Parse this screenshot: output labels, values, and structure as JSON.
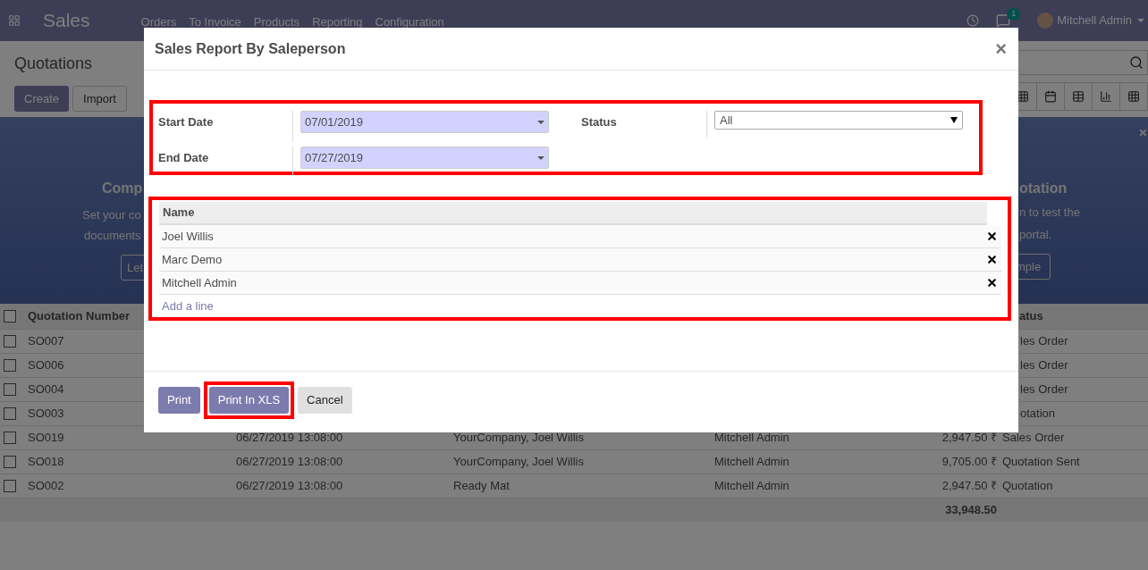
{
  "navbar": {
    "app": "Sales",
    "menu": [
      "Orders",
      "To Invoice",
      "Products",
      "Reporting",
      "Configuration"
    ],
    "notifications": "1",
    "user": "Mitchell Admin"
  },
  "control_panel": {
    "title": "Quotations",
    "buttons": [
      {
        "label": "Create",
        "kind": "primary"
      },
      {
        "label": "Import",
        "kind": "secondary"
      }
    ]
  },
  "banner": {
    "left": {
      "heading": "Comp",
      "lines": [
        "Set your co",
        "documents"
      ],
      "button": "Let"
    },
    "right": {
      "heading": "otation",
      "lines": [
        "n to test the",
        "portal."
      ],
      "button": "mple"
    }
  },
  "table": {
    "columns": [
      {
        "label": "Quotation Number",
        "kind": "number"
      },
      {
        "label": "atus",
        "kind": "status"
      }
    ],
    "rows": [
      {
        "kind": "covered",
        "checked": false,
        "number": "SO007",
        "status": "les Order"
      },
      {
        "kind": "covered",
        "checked": false,
        "number": "SO006",
        "status": "les Order"
      },
      {
        "kind": "covered",
        "checked": false,
        "number": "SO004",
        "status": "les Order"
      },
      {
        "kind": "covered",
        "checked": false,
        "number": "SO003",
        "status": "otation"
      },
      {
        "kind": "full",
        "checked": false,
        "number": "SO019",
        "date": "06/27/2019 13:08:00",
        "customer": "YourCompany, Joel Willis",
        "salesperson": "Mitchell Admin",
        "total": "2,947.50 ₹",
        "status": "Sales Order"
      },
      {
        "kind": "full",
        "checked": false,
        "number": "SO018",
        "date": "06/27/2019 13:08:00",
        "customer": "YourCompany, Joel Willis",
        "salesperson": "Mitchell Admin",
        "total": "9,705.00 ₹",
        "status": "Quotation Sent"
      },
      {
        "kind": "full",
        "checked": false,
        "number": "SO002",
        "date": "06/27/2019 13:08:00",
        "customer": "Ready Mat",
        "salesperson": "Mitchell Admin",
        "total": "2,947.50 ₹",
        "status": "Quotation"
      }
    ],
    "total": "33,948.50",
    "all_checked": false
  },
  "dialog": {
    "title": "Sales Report By Saleperson",
    "close": "×",
    "filters": {
      "highlighted": true,
      "start_date": {
        "label": "Start Date",
        "value": "07/01/2019"
      },
      "end_date": {
        "label": "End Date",
        "value": "07/27/2019"
      },
      "status": {
        "label": "Status",
        "value": "All"
      }
    },
    "salespersons": {
      "highlighted": true,
      "column": "Name",
      "rows": [
        "Joel Willis",
        "Marc Demo",
        "Mitchell Admin"
      ],
      "add_line": "Add a line"
    },
    "buttons": [
      {
        "label": "Print",
        "kind": "primary",
        "highlighted": false
      },
      {
        "label": "Print In XLS",
        "kind": "primary",
        "highlighted": true
      },
      {
        "label": "Cancel",
        "kind": "secondary",
        "highlighted": false
      }
    ]
  }
}
